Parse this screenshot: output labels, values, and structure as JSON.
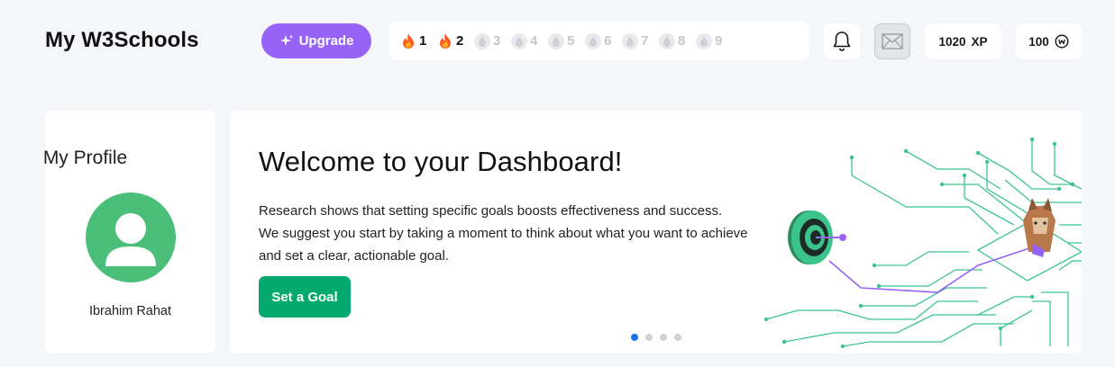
{
  "header": {
    "brand": "My W3Schools",
    "upgrade_label": "Upgrade",
    "upgrade_icon": "sparkle-icon",
    "streak_days": [
      {
        "n": "1",
        "state": "active"
      },
      {
        "n": "2",
        "state": "active"
      },
      {
        "n": "3",
        "state": "inactive"
      },
      {
        "n": "4",
        "state": "inactive"
      },
      {
        "n": "5",
        "state": "inactive"
      },
      {
        "n": "6",
        "state": "inactive"
      },
      {
        "n": "7",
        "state": "inactive"
      },
      {
        "n": "8",
        "state": "inactive"
      },
      {
        "n": "9",
        "state": "inactive"
      }
    ],
    "bell_icon": "bell-icon",
    "mail_icon": "envelope-icon",
    "xp_value": "1020",
    "xp_label": "XP",
    "coins_value": "100",
    "coin_icon": "coin-icon"
  },
  "profile": {
    "title": "My Profile",
    "name": "Ibrahim Rahat"
  },
  "welcome": {
    "title": "Welcome to your Dashboard!",
    "line1": "Research shows that setting specific goals boosts effectiveness and success.",
    "line2": "We suggest you start by taking a moment to think about what you want to achieve",
    "line3": "and set a clear, actionable goal.",
    "button": "Set a Goal",
    "carousel_active_index": 0,
    "carousel_count": 4
  },
  "colors": {
    "accent_purple": "#9763f6",
    "accent_green": "#04aa6d",
    "avatar_green": "#4bbf79",
    "circuit_green": "#3cc48d"
  }
}
